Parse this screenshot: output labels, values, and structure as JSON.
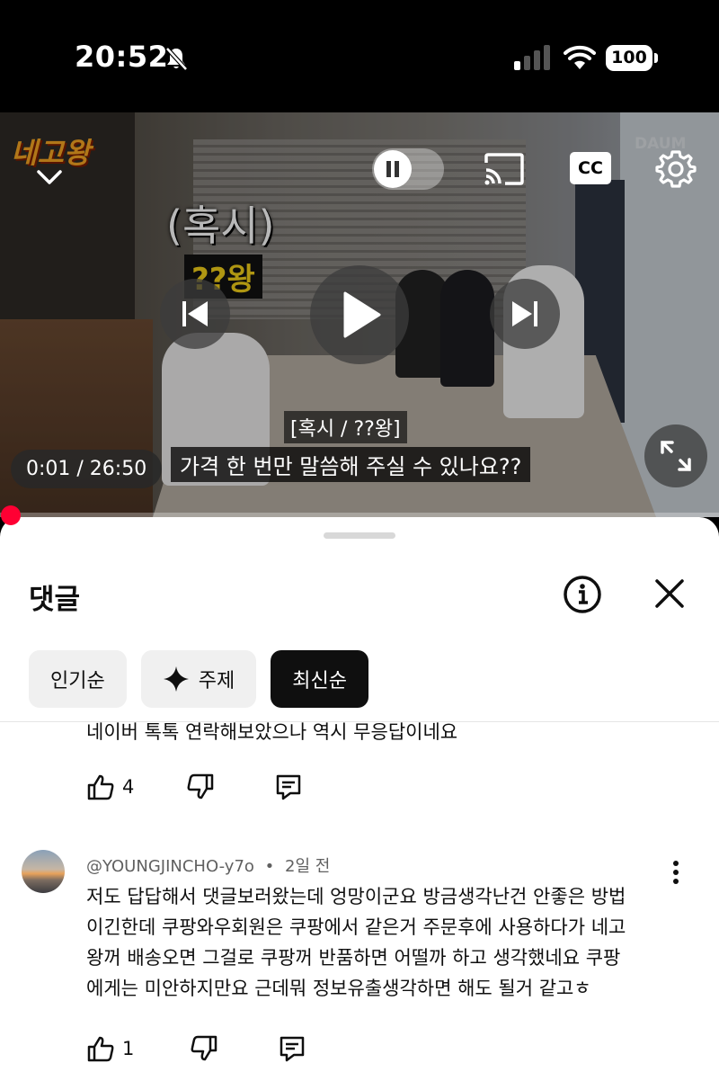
{
  "status_bar": {
    "time": "20:52",
    "battery": "100"
  },
  "video": {
    "brand_logo": "네고왕",
    "watermark": "DAUM",
    "caption_top": "(혹시)",
    "caption_name": "??왕",
    "subtitle_speaker": "[혹시 / ??왕]",
    "subtitle_line": "가격 한 번만 말씀해 주실 수 있나요??",
    "time_display": "0:01 / 26:50",
    "progress_fraction": 0.0006,
    "cc_label": "CC"
  },
  "comments_panel": {
    "title": "댓글",
    "chips": [
      {
        "label": "인기순",
        "active": false
      },
      {
        "label": "주제",
        "active": false,
        "icon": "sparkle-icon"
      },
      {
        "label": "최신순",
        "active": true
      }
    ],
    "comments": [
      {
        "text": "네이버 톡톡 연락해보았으나 역시 무응답이네요",
        "likes": "4"
      },
      {
        "author": "@YOUNGJINCHO-y7o",
        "separator": "•",
        "time": "2일 전",
        "lines": [
          "저도 답답해서 댓글보러왔는데 엉망이군요 방금생각난건 안좋은 방법",
          "이긴한데 쿠팡와우회원은 쿠팡에서 같은거 주문후에 사용하다가 네고",
          "왕꺼 배송오면 그걸로 쿠팡꺼 반품하면 어떨까 하고 생각했네요  쿠팡",
          "에게는 미안하지만요 근데뭐 정보유출생각하면 해도 될거 같고ㅎ"
        ],
        "likes": "1"
      }
    ]
  }
}
